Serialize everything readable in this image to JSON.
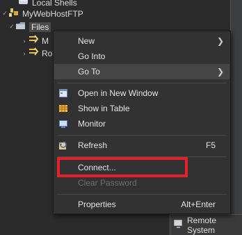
{
  "tree": {
    "local_shells": "Local Shells",
    "connection": "MyWebHostFTP",
    "files": "Files",
    "child1": "M",
    "child2": "Ro"
  },
  "context_menu": {
    "new": "New",
    "go_into": "Go Into",
    "go_to": "Go To",
    "open_in_new_window": "Open in New Window",
    "show_in_table": "Show in Table",
    "monitor": "Monitor",
    "refresh": "Refresh",
    "refresh_shortcut": "F5",
    "connect": "Connect...",
    "clear_password": "Clear Password",
    "properties": "Properties",
    "properties_shortcut": "Alt+Enter"
  },
  "bottom_tab": {
    "label": "Remote System"
  },
  "colors": {
    "highlight_border": "#e3232c",
    "menu_bg": "#323232",
    "tree_bg": "#2b2b2b"
  }
}
